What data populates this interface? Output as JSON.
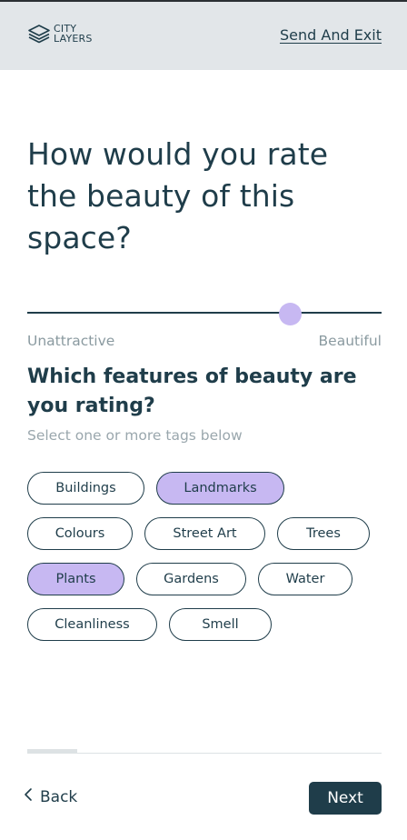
{
  "header": {
    "logo_line1": "CITY",
    "logo_line2": "LAYERS",
    "send_exit_label": "Send And Exit"
  },
  "question": "How would you rate the beauty of this space?",
  "slider": {
    "value_fraction": 0.741,
    "min_label": "Unattractive",
    "max_label": "Beautiful"
  },
  "features": {
    "title": "Which features of beauty are you rating?",
    "subtitle": "Select one or more tags below",
    "tags": [
      {
        "label": "Buildings",
        "selected": false
      },
      {
        "label": "Landmarks",
        "selected": true
      },
      {
        "label": "Colours",
        "selected": false
      },
      {
        "label": "Street Art",
        "selected": false
      },
      {
        "label": "Trees",
        "selected": false
      },
      {
        "label": "Plants",
        "selected": true
      },
      {
        "label": "Gardens",
        "selected": false
      },
      {
        "label": "Water",
        "selected": false
      },
      {
        "label": "Cleanliness",
        "selected": false
      },
      {
        "label": "Smell",
        "selected": false
      }
    ]
  },
  "progress": {
    "fraction": 0.14
  },
  "footer": {
    "back_label": "Back",
    "next_label": "Next"
  },
  "colors": {
    "primary": "#1f3d4a",
    "accent": "#c7b8f2",
    "header_bg": "#e2e6e9",
    "muted_text": "#8a9aa0"
  },
  "icons": {
    "logo": "stacked-layers-icon",
    "back": "chevron-left-icon"
  }
}
